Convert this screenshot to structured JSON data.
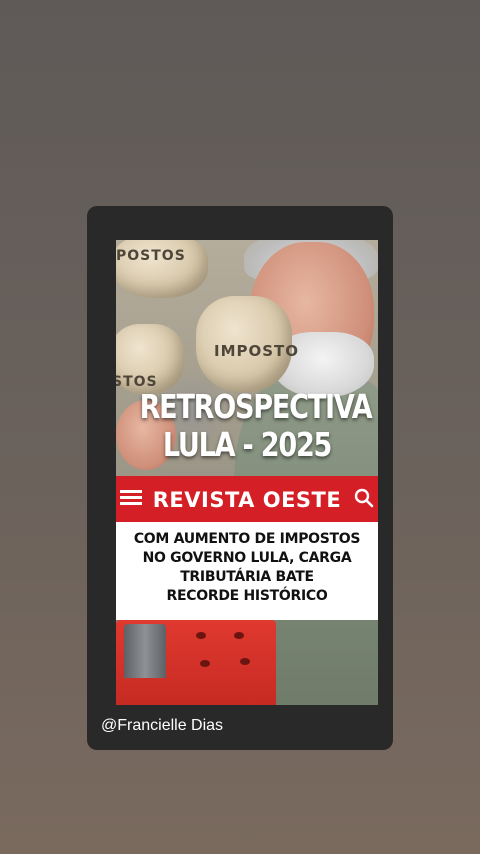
{
  "post": {
    "headline_line1": "RETROSPECTIVA",
    "headline_line2": "LULA - 2025",
    "sack_labels": [
      "POSTOS",
      "IMPOSTO",
      "STOS"
    ],
    "magazine": {
      "name": "REVISTA OESTE",
      "accent_color": "#d41f26"
    },
    "article": {
      "lines": [
        "COM AUMENTO DE IMPOSTOS",
        "NO GOVERNO LULA, CARGA",
        "TRIBUTÁRIA BATE",
        "RECORDE HISTÓRICO"
      ]
    },
    "author": "@Francielle Dias"
  },
  "icons": {
    "menu": "hamburger-menu-icon",
    "search": "search-icon"
  }
}
